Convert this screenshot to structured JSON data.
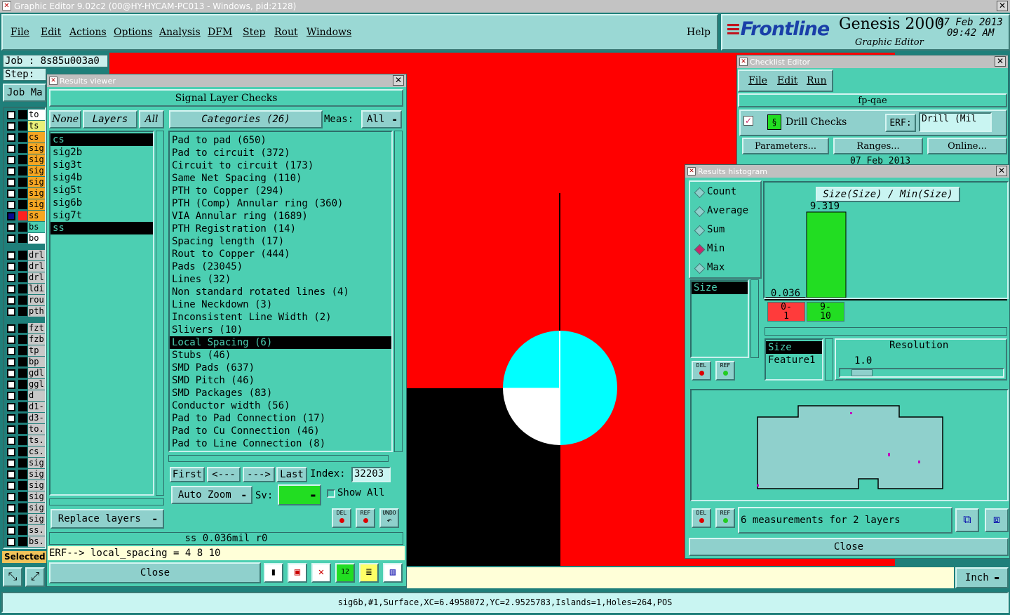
{
  "window": {
    "title": "Graphic Editor 9.02c2 (00@HY-HYCAM-PC013 - Windows, pid:2128)"
  },
  "menu": {
    "items": [
      "File",
      "Edit",
      "Actions",
      "Options",
      "Analysis",
      "DFM",
      "Step",
      "Rout",
      "Windows"
    ],
    "help": "Help"
  },
  "brand": {
    "logo": "Frontline",
    "product": "Genesis 2000",
    "subtitle": "Graphic Editor",
    "date": "07 Feb 2013",
    "time": "09:42 AM"
  },
  "job": {
    "label": "Job : 8s85u003a0",
    "step": "Step: c",
    "job_manager": "Job Ma"
  },
  "layers_panel": {
    "rows": [
      {
        "name": "to",
        "color": "#ffffff"
      },
      {
        "name": "ts",
        "color": "#e8f07a"
      },
      {
        "name": "cs",
        "color": "#f5a623"
      },
      {
        "name": "sig",
        "color": "#f5a623"
      },
      {
        "name": "sig",
        "color": "#f5a623"
      },
      {
        "name": "sig",
        "color": "#f5a623"
      },
      {
        "name": "sig",
        "color": "#f5a623"
      },
      {
        "name": "sig",
        "color": "#f5a623"
      },
      {
        "name": "sig",
        "color": "#f5a623"
      },
      {
        "name": "ss",
        "color": "#f5a623"
      },
      {
        "name": "bs",
        "color": "#4ccfb2"
      },
      {
        "name": "bo",
        "color": "#ffffff"
      },
      {
        "name": "drl",
        "color": "#c8c8c8"
      },
      {
        "name": "drl",
        "color": "#c8c8c8"
      },
      {
        "name": "drl",
        "color": "#c8c8c8"
      },
      {
        "name": "ldi",
        "color": "#c8c8c8"
      },
      {
        "name": "rou",
        "color": "#c8c8c8"
      },
      {
        "name": "pth",
        "color": "#c8c8c8"
      },
      {
        "name": "fzt",
        "color": "#c8c8c8"
      },
      {
        "name": "fzb",
        "color": "#c8c8c8"
      },
      {
        "name": "tp",
        "color": "#c8c8c8"
      },
      {
        "name": "bp",
        "color": "#c8c8c8"
      },
      {
        "name": "gdl",
        "color": "#c8c8c8"
      },
      {
        "name": "ggl",
        "color": "#c8c8c8"
      },
      {
        "name": "d",
        "color": "#c8c8c8"
      },
      {
        "name": "d1-",
        "color": "#c8c8c8"
      },
      {
        "name": "d3-",
        "color": "#c8c8c8"
      },
      {
        "name": "to.",
        "color": "#c8c8c8"
      },
      {
        "name": "ts.",
        "color": "#c8c8c8"
      },
      {
        "name": "cs.",
        "color": "#c8c8c8"
      },
      {
        "name": "sig",
        "color": "#c8c8c8"
      },
      {
        "name": "sig",
        "color": "#c8c8c8"
      },
      {
        "name": "sig",
        "color": "#c8c8c8"
      },
      {
        "name": "sig",
        "color": "#c8c8c8"
      },
      {
        "name": "sig",
        "color": "#c8c8c8"
      },
      {
        "name": "sig",
        "color": "#c8c8c8"
      },
      {
        "name": "ss.",
        "color": "#c8c8c8"
      },
      {
        "name": "bs.",
        "color": "#c8c8c8"
      }
    ],
    "selected_label": "Selected"
  },
  "results_viewer": {
    "title": "Results viewer",
    "header": "Signal Layer Checks",
    "btn_none": "None",
    "btn_layers": "Layers",
    "btn_all": "All",
    "layers": [
      "cs",
      "sig2b",
      "sig3t",
      "sig4b",
      "sig5t",
      "sig6b",
      "sig7t",
      "ss"
    ],
    "categories_label": "Categories (26)",
    "meas_label": "Meas:",
    "meas_value": "All",
    "categories": [
      "Pad to pad (650)",
      "Pad to circuit (372)",
      "Circuit to circuit (173)",
      "Same Net Spacing (110)",
      "PTH to Copper (294)",
      "PTH (Comp) Annular ring (360)",
      "VIA Annular ring (1689)",
      "PTH Registration (14)",
      "Spacing length (17)",
      "Rout to Copper (444)",
      "Pads (23045)",
      "Lines (32)",
      "Non standard rotated lines (4)",
      "Line Neckdown (3)",
      "Inconsistent Line Width (2)",
      "Slivers (10)",
      "Local Spacing (6)",
      "Stubs (46)",
      "SMD Pads (637)",
      "SMD Pitch (46)",
      "SMD Packages (83)",
      "Conductor width (56)",
      "Pad to Pad Connection (17)",
      "Pad to Cu Connection (46)",
      "Pad to Line Connection (8)"
    ],
    "nav_first": "First",
    "nav_prev": "<---",
    "nav_next": "--->",
    "nav_last": "Last",
    "index_label": "Index:",
    "index_value": "32203",
    "auto_zoom": "Auto Zoom",
    "sv_label": "Sv:",
    "show_all": "Show All",
    "replace_layers": "Replace layers",
    "status": "ss 0.036mil  r0",
    "erf_line": "ERF--> local_spacing = 4 8 10",
    "close": "Close",
    "del": "DEL",
    "ref": "REF",
    "undo": "UNDO"
  },
  "checklist": {
    "title": "Checklist Editor",
    "menu": [
      "File",
      "Edit",
      "Run"
    ],
    "name": "fp-qae",
    "check_name": "Drill Checks",
    "erf_label": "ERF:",
    "erf_value": "Drill (Mil",
    "parameters": "Parameters...",
    "ranges": "Ranges...",
    "online": "Online...",
    "date": "07 Feb 2013"
  },
  "histogram": {
    "title": "Results histogram",
    "modes": [
      "Count",
      "Average",
      "Sum",
      "Min",
      "Max"
    ],
    "selected_mode": "Min",
    "chart_title": "Size(Size) / Min(Size)",
    "max_value": "9.319",
    "min_value": "0.036",
    "bins": [
      {
        "label1": "0-",
        "label2": "1",
        "color": "#ff3b3b"
      },
      {
        "label1": "9-",
        "label2": "10",
        "color": "#22dd22"
      }
    ],
    "list_items": [
      "Size"
    ],
    "attr_items": [
      "Size",
      "Feature1"
    ],
    "resolution_label": "Resolution",
    "resolution_value": "1.0",
    "measurements": "6 measurements for 2 layers",
    "close": "Close"
  },
  "units": "Inch",
  "status_bar": "sig6b,#1,Surface,XC=6.4958072,YC=2.9525783,Islands=1,Holes=264,POS",
  "chart_data": {
    "type": "bar",
    "categories": [
      "0-1",
      "9-10"
    ],
    "values": [
      0.036,
      9.319
    ],
    "title": "Size(Size) / Min(Size)",
    "xlabel": "",
    "ylabel": ""
  }
}
